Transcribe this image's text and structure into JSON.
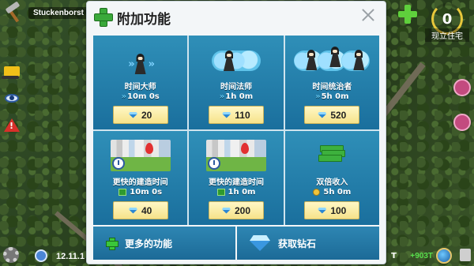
{
  "hud": {
    "city_name": "Stuckenborst",
    "housing_count": "0",
    "housing_label": "现立住宅",
    "date": "12.11.1",
    "money_prefix": "T",
    "money_delta": "+903T"
  },
  "dialog": {
    "title": "附加功能",
    "items": [
      {
        "name": "时间大师",
        "duration": "10m 0s",
        "price": "20",
        "icon": "fast-forward-icon"
      },
      {
        "name": "时间法师",
        "duration": "1h 0m",
        "price": "110",
        "icon": "fast-forward-icon"
      },
      {
        "name": "时间统治者",
        "duration": "5h 0m",
        "price": "520",
        "icon": "fast-forward-icon"
      },
      {
        "name": "更快的建造时间",
        "duration": "10m 0s",
        "price": "40",
        "icon": "cash-icon"
      },
      {
        "name": "更快的建造时间",
        "duration": "1h 0m",
        "price": "200",
        "icon": "cash-icon"
      },
      {
        "name": "双倍收入",
        "duration": "5h 0m",
        "price": "100",
        "icon": "coin-icon"
      }
    ],
    "more_features_label": "更多的功能",
    "get_diamonds_label": "获取钻石"
  },
  "colors": {
    "tile_blue": "#1a6f9d",
    "price_yellow": "#f6e38a",
    "accent_green": "#3aa93a"
  }
}
